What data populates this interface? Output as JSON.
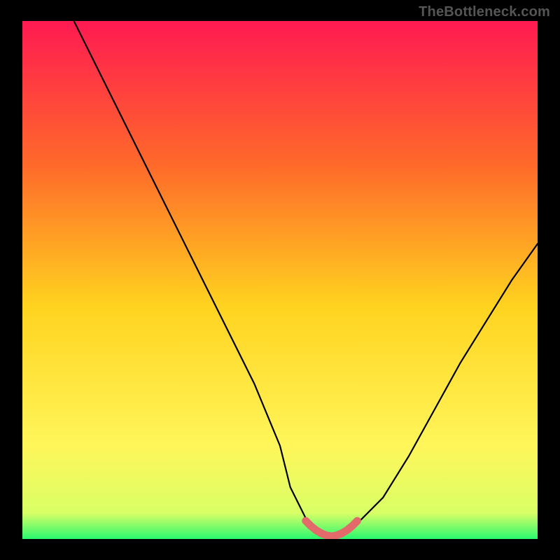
{
  "watermark": "TheBottleneck.com",
  "colors": {
    "bg": "#000000",
    "watermark": "#555555",
    "gradient_top": "#ff1a51",
    "gradient_mid1": "#ff7a1f",
    "gradient_mid2": "#ffd31f",
    "gradient_mid3": "#fff65a",
    "gradient_bottom": "#29f86e",
    "curve": "#000000",
    "marker": "#e26a6a"
  },
  "chart_data": {
    "type": "line",
    "title": "",
    "xlabel": "",
    "ylabel": "",
    "xlim": [
      0,
      100
    ],
    "ylim": [
      0,
      100
    ],
    "series": [
      {
        "name": "bottleneck-curve",
        "x": [
          10,
          15,
          20,
          25,
          30,
          35,
          40,
          45,
          50,
          52,
          55,
          58,
          60,
          62,
          65,
          70,
          75,
          80,
          85,
          90,
          95,
          100
        ],
        "y": [
          100,
          90,
          80,
          70,
          60,
          50,
          40,
          30,
          18,
          10,
          4,
          1,
          0,
          1,
          3,
          8,
          16,
          25,
          34,
          42,
          50,
          57
        ]
      }
    ],
    "marker": {
      "name": "optimal-range",
      "x": [
        55,
        56,
        57,
        58,
        59,
        60,
        61,
        62,
        63,
        64,
        65
      ],
      "y": [
        3.5,
        2.5,
        1.7,
        1.1,
        0.7,
        0.5,
        0.7,
        1.1,
        1.7,
        2.5,
        3.5
      ]
    },
    "gradient_stops": [
      {
        "offset": 0,
        "meaning": "severe-bottleneck"
      },
      {
        "offset": 50,
        "meaning": "moderate"
      },
      {
        "offset": 90,
        "meaning": "minor"
      },
      {
        "offset": 100,
        "meaning": "optimal"
      }
    ]
  }
}
